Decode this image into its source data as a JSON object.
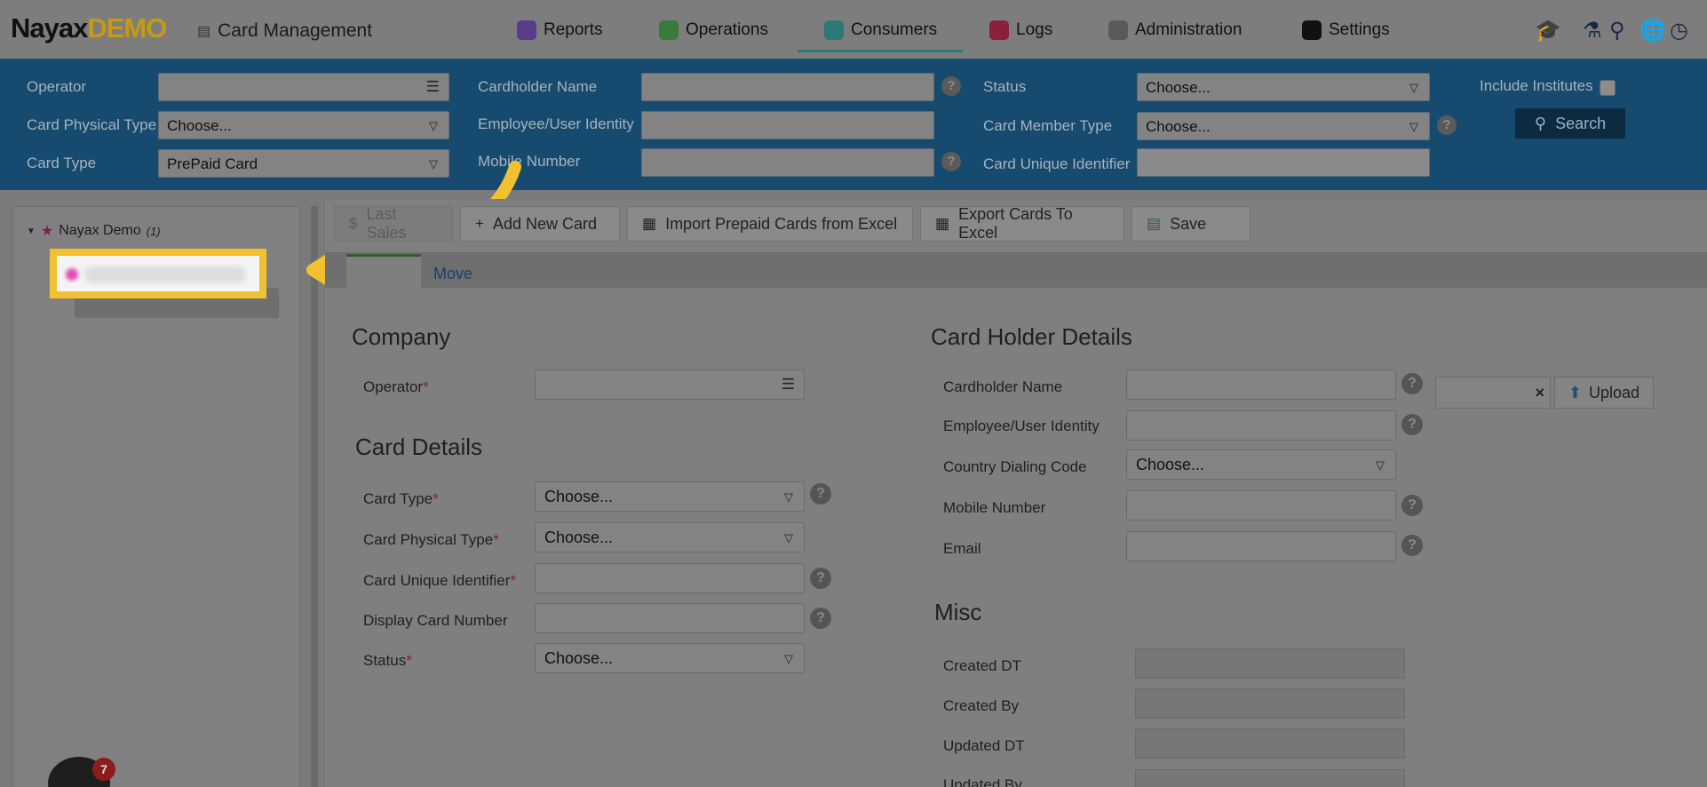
{
  "app": {
    "logo_main": "Nayax",
    "logo_demo": "DEMO",
    "page_title": "Card Management"
  },
  "nav": {
    "items": [
      {
        "label": "Reports",
        "color": "#5a3d8a"
      },
      {
        "label": "Operations",
        "color": "#3a7a3a"
      },
      {
        "label": "Consumers",
        "color": "#2c7a76"
      },
      {
        "label": "Logs",
        "color": "#8c1f3a"
      },
      {
        "label": "Administration",
        "color": "#5a5a5a"
      },
      {
        "label": "Settings",
        "color": "#111111"
      }
    ],
    "active": "Consumers",
    "right_icons": [
      "graduation-cap-icon",
      "flask-icon",
      "search-icon",
      "globe-icon",
      "clock-icon"
    ]
  },
  "filters": {
    "operator_label": "Operator",
    "operator_value": "",
    "card_physical_type_label": "Card Physical Type",
    "card_physical_type_value": "Choose...",
    "card_type_label": "Card Type",
    "card_type_value": "PrePaid Card",
    "cardholder_name_label": "Cardholder Name",
    "cardholder_name_value": "",
    "employee_identity_label": "Employee/User Identity",
    "employee_identity_value": "",
    "mobile_number_label": "Mobile Number",
    "mobile_number_value": "",
    "status_label": "Status",
    "status_value": "Choose...",
    "card_member_type_label": "Card Member Type",
    "card_member_type_value": "Choose...",
    "card_unique_id_label": "Card Unique Identifier",
    "card_unique_id_value": "",
    "include_institutes_label": "Include Institutes",
    "include_institutes_checked": false,
    "search_label": "Search"
  },
  "tree": {
    "root_label": "Nayax Demo",
    "root_count": "(1)"
  },
  "toolbar": {
    "last_sales": "Last Sales",
    "add_new_card": "Add New Card",
    "import_prepaid": "Import Prepaid Cards from Excel",
    "export_cards": "Export Cards To Excel",
    "save": "Save"
  },
  "tabs": {
    "move": "Move"
  },
  "company": {
    "title": "Company",
    "operator_label": "Operator",
    "operator_value": ""
  },
  "card_details": {
    "title": "Card Details",
    "card_type_label": "Card Type",
    "card_type_value": "Choose...",
    "card_physical_type_label": "Card Physical Type",
    "card_physical_type_value": "Choose...",
    "card_unique_id_label": "Card Unique Identifier",
    "card_unique_id_value": "",
    "display_card_number_label": "Display Card Number",
    "display_card_number_value": "",
    "status_label": "Status",
    "status_value": "Choose..."
  },
  "card_holder": {
    "title": "Card Holder Details",
    "cardholder_name_label": "Cardholder Name",
    "employee_identity_label": "Employee/User Identity",
    "country_code_label": "Country Dialing Code",
    "country_code_value": "Choose...",
    "mobile_number_label": "Mobile Number",
    "email_label": "Email",
    "upload_label": "Upload"
  },
  "misc": {
    "title": "Misc",
    "created_dt_label": "Created DT",
    "created_by_label": "Created By",
    "updated_dt_label": "Updated DT",
    "updated_by_label": "Updated By"
  },
  "notifications": {
    "count": "7"
  },
  "required_mark": "*",
  "help_glyph": "?"
}
